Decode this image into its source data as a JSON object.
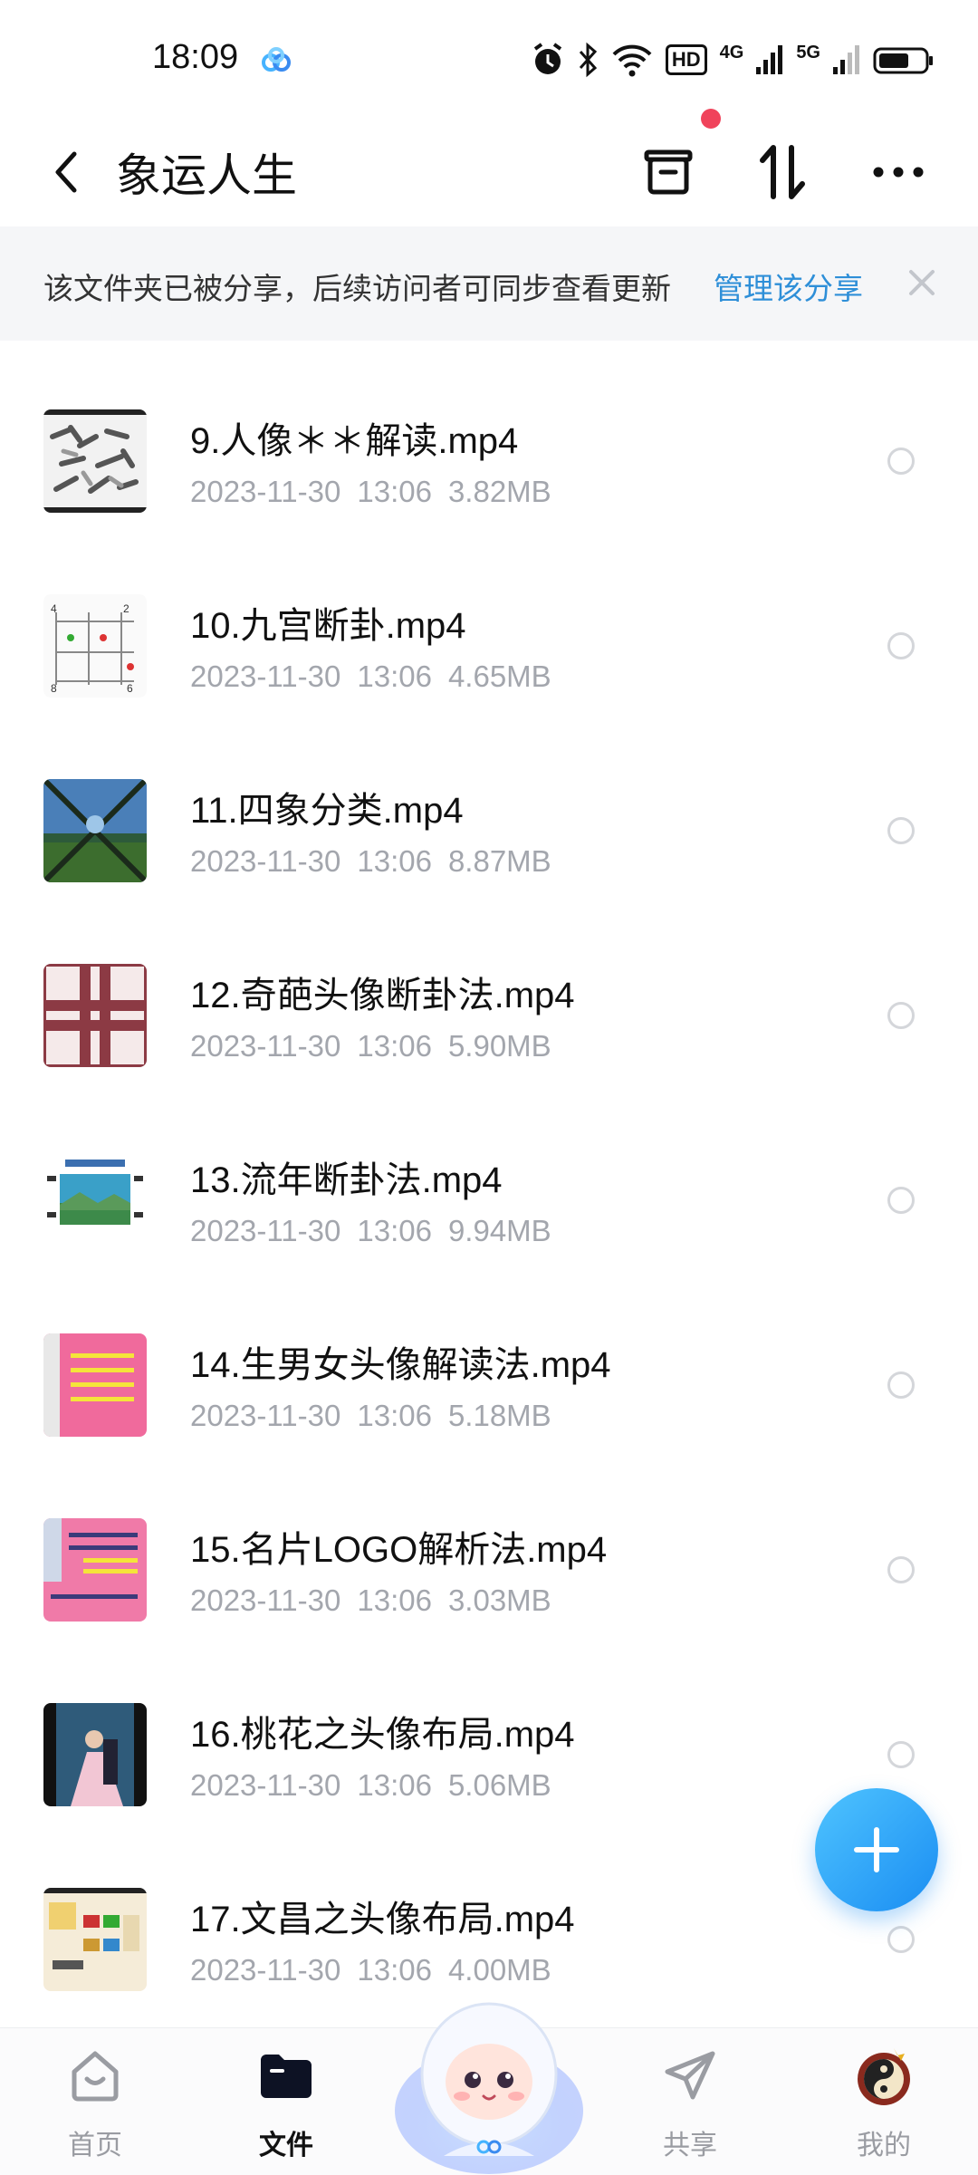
{
  "status_bar": {
    "time": "18:09",
    "hd_label": "HD",
    "net1": "4G",
    "net2": "5G"
  },
  "header": {
    "title": "象运人生"
  },
  "banner": {
    "text": "该文件夹已被分享，后续访问者可同步查看更新",
    "link": "管理该分享"
  },
  "files": [
    {
      "name": "9.人像＊＊解读.mp4",
      "date": "2023-11-30",
      "time": "13:06",
      "size": "3.82MB"
    },
    {
      "name": "10.九宫断卦.mp4",
      "date": "2023-11-30",
      "time": "13:06",
      "size": "4.65MB"
    },
    {
      "name": "11.四象分类.mp4",
      "date": "2023-11-30",
      "time": "13:06",
      "size": "8.87MB"
    },
    {
      "name": "12.奇葩头像断卦法.mp4",
      "date": "2023-11-30",
      "time": "13:06",
      "size": "5.90MB"
    },
    {
      "name": "13.流年断卦法.mp4",
      "date": "2023-11-30",
      "time": "13:06",
      "size": "9.94MB"
    },
    {
      "name": "14.生男女头像解读法.mp4",
      "date": "2023-11-30",
      "time": "13:06",
      "size": "5.18MB"
    },
    {
      "name": "15.名片LOGO解析法.mp4",
      "date": "2023-11-30",
      "time": "13:06",
      "size": "3.03MB"
    },
    {
      "name": "16.桃花之头像布局.mp4",
      "date": "2023-11-30",
      "time": "13:06",
      "size": "5.06MB"
    },
    {
      "name": "17.文昌之头像布局.mp4",
      "date": "2023-11-30",
      "time": "13:06",
      "size": "4.00MB"
    }
  ],
  "nav": [
    {
      "label": "首页"
    },
    {
      "label": "文件"
    },
    {
      "label": "共享"
    },
    {
      "label": "我的"
    }
  ],
  "colors": {
    "accent": "#2e8fd8",
    "fab": "#1a8df2",
    "badge": "#f0435b"
  }
}
